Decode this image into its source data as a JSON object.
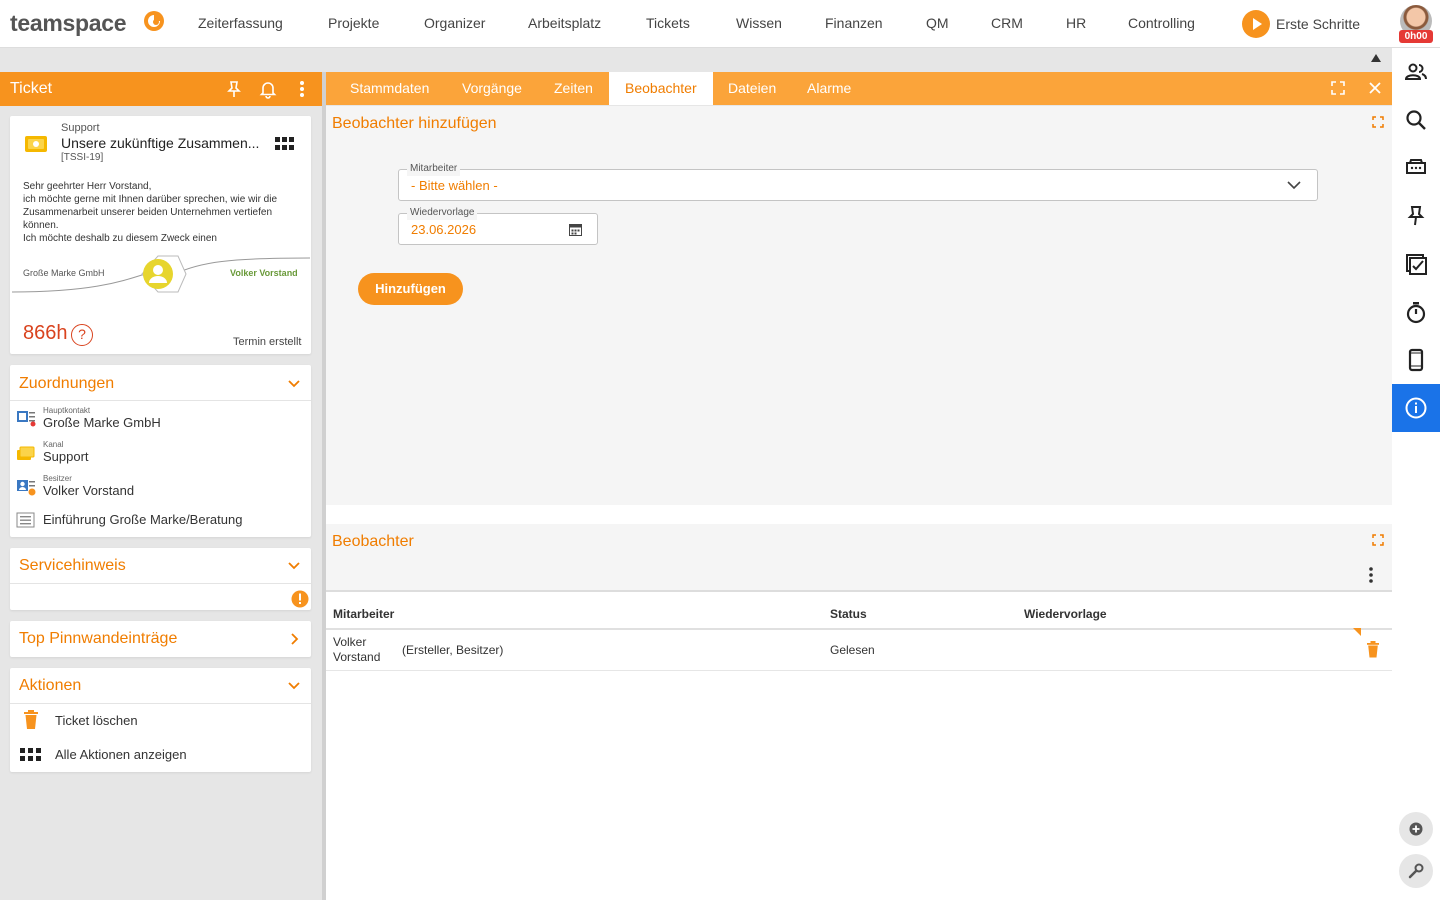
{
  "app": {
    "logo": "teamspace"
  },
  "nav": {
    "items": [
      "Zeiterfassung",
      "Projekte",
      "Organizer",
      "Arbeitsplatz",
      "Tickets",
      "Wissen",
      "Finanzen",
      "QM",
      "CRM",
      "HR",
      "Controlling"
    ],
    "erste_schritte": "Erste Schritte",
    "timer_badge": "0h00"
  },
  "ticket_panel": {
    "title": "Ticket",
    "summary": {
      "channel": "Support",
      "title": "Unsere zukünftige Zusammen...",
      "id": "[TSSI-19]",
      "body": "Sehr geehrter Herr Vorstand,\nich möchte gerne mit Ihnen darüber sprechen, wie wir die Zusammenarbeit unserer beiden Unternehmen vertiefen können.\nIch möchte deshalb zu diesem Zweck einen",
      "from": "Große Marke GmbH",
      "to": "Volker Vorstand",
      "hours": "866h",
      "help": "?",
      "status": "Termin erstellt"
    },
    "zuordnungen": {
      "title": "Zuordnungen",
      "rows": [
        {
          "label": "Hauptkontakt",
          "value": "Große Marke GmbH"
        },
        {
          "label": "Kanal",
          "value": "Support"
        },
        {
          "label": "Besitzer",
          "value": "Volker Vorstand"
        },
        {
          "label": "",
          "value": "Einführung Große Marke/Beratung"
        }
      ]
    },
    "servicehinweis": {
      "title": "Servicehinweis"
    },
    "pinnwand": {
      "title": "Top Pinnwandeinträge"
    },
    "aktionen": {
      "title": "Aktionen",
      "items": [
        "Ticket löschen",
        "Alle Aktionen anzeigen"
      ]
    }
  },
  "tabs": [
    "Stammdaten",
    "Vorgänge",
    "Zeiten",
    "Beobachter",
    "Dateien",
    "Alarme"
  ],
  "active_tab": "Beobachter",
  "add_panel": {
    "title": "Beobachter hinzufügen",
    "mitarbeiter_label": "Mitarbeiter",
    "mitarbeiter_value": "- Bitte wählen -",
    "wiedervorlage_label": "Wiedervorlage",
    "wiedervorlage_value": "23.06.2026",
    "button": "Hinzufügen"
  },
  "observers": {
    "title": "Beobachter",
    "columns": [
      "Mitarbeiter",
      "Status",
      "Wiedervorlage"
    ],
    "rows": [
      {
        "name_line1": "Volker",
        "name_line2": "Vorstand",
        "role": "(Ersteller, Besitzer)",
        "status": "Gelesen",
        "wiedervorlage": ""
      }
    ]
  },
  "colors": {
    "accent": "#f7931e",
    "accent_text": "#f07d00",
    "active_sidebar": "#1a73e8",
    "hours": "#d9431e"
  }
}
